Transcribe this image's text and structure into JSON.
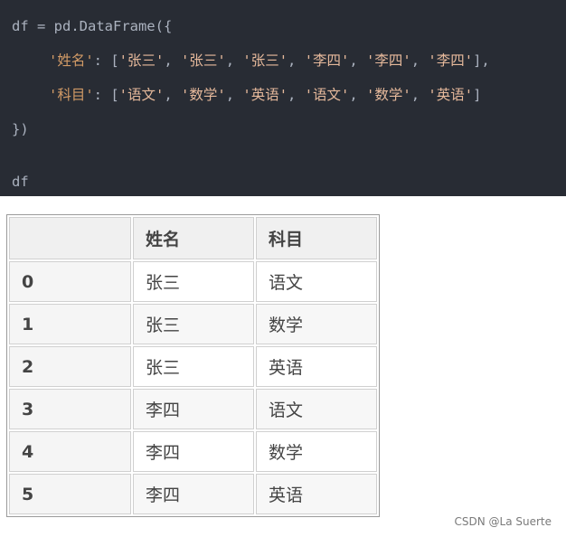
{
  "code": {
    "line1": "df = pd.DataFrame({",
    "line2_key": "'姓名'",
    "line2_colon": ": [",
    "line2_vals": [
      "'张三'",
      "'张三'",
      "'张三'",
      "'李四'",
      "'李四'",
      "'李四'"
    ],
    "line2_end": "],",
    "line3_key": "'科目'",
    "line3_colon": ": [",
    "line3_vals": [
      "'语文'",
      "'数学'",
      "'英语'",
      "'语文'",
      "'数学'",
      "'英语'"
    ],
    "line3_end": "]",
    "line4": "})",
    "line5": "df",
    "sep": ", "
  },
  "table": {
    "headers": [
      "",
      "姓名",
      "科目"
    ],
    "rows": [
      {
        "index": "0",
        "name": "张三",
        "subject": "语文"
      },
      {
        "index": "1",
        "name": "张三",
        "subject": "数学"
      },
      {
        "index": "2",
        "name": "张三",
        "subject": "英语"
      },
      {
        "index": "3",
        "name": "李四",
        "subject": "语文"
      },
      {
        "index": "4",
        "name": "李四",
        "subject": "数学"
      },
      {
        "index": "5",
        "name": "李四",
        "subject": "英语"
      }
    ]
  },
  "watermark": "CSDN @La Suerte"
}
